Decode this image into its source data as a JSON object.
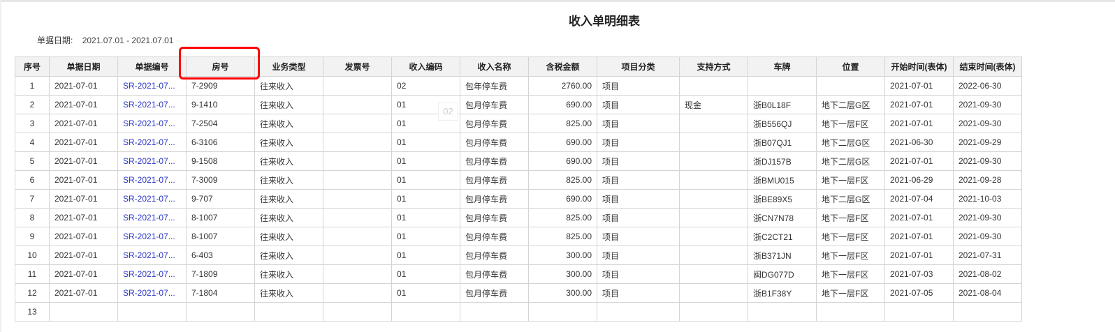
{
  "report": {
    "title": "收入单明细表",
    "date_label": "单据日期:",
    "date_range": "2021.07.01 - 2021.07.01",
    "page_marker": "02"
  },
  "colors": {
    "header_bg": "#f2f2f2",
    "link": "#2a35c8",
    "highlight": "#ff0000",
    "border": "#d4d4d4"
  },
  "table": {
    "columns": [
      "序号",
      "单据日期",
      "单据编号",
      "房号",
      "业务类型",
      "发票号",
      "收入编码",
      "收入名称",
      "含税金额",
      "项目分类",
      "支持方式",
      "车牌",
      "位置",
      "开始时间(表体)",
      "结束时间(表体)"
    ],
    "rows": [
      [
        "1",
        "2021-07-01",
        "SR-2021-07...",
        "7-2909",
        "往来收入",
        "",
        "02",
        "包年停车费",
        "2760.00",
        "项目",
        "",
        "",
        "",
        "2021-07-01",
        "2022-06-30"
      ],
      [
        "2",
        "2021-07-01",
        "SR-2021-07...",
        "9-1410",
        "往来收入",
        "",
        "01",
        "包月停车费",
        "690.00",
        "项目",
        "现金",
        "浙B0L18F",
        "地下二层G区",
        "2021-07-01",
        "2021-09-30"
      ],
      [
        "3",
        "2021-07-01",
        "SR-2021-07...",
        "7-2504",
        "往来收入",
        "",
        "01",
        "包月停车费",
        "825.00",
        "项目",
        "",
        "浙B556QJ",
        "地下一层F区",
        "2021-07-01",
        "2021-09-30"
      ],
      [
        "4",
        "2021-07-01",
        "SR-2021-07...",
        "6-3106",
        "往来收入",
        "",
        "01",
        "包月停车费",
        "690.00",
        "项目",
        "",
        "浙B07QJ1",
        "地下二层G区",
        "2021-06-30",
        "2021-09-29"
      ],
      [
        "5",
        "2021-07-01",
        "SR-2021-07...",
        "9-1508",
        "往来收入",
        "",
        "01",
        "包月停车费",
        "690.00",
        "项目",
        "",
        "浙DJ157B",
        "地下二层G区",
        "2021-07-01",
        "2021-09-30"
      ],
      [
        "6",
        "2021-07-01",
        "SR-2021-07...",
        "7-3009",
        "往来收入",
        "",
        "01",
        "包月停车费",
        "825.00",
        "项目",
        "",
        "浙BMU015",
        "地下一层F区",
        "2021-06-29",
        "2021-09-28"
      ],
      [
        "7",
        "2021-07-01",
        "SR-2021-07...",
        "9-707",
        "往来收入",
        "",
        "01",
        "包月停车费",
        "690.00",
        "项目",
        "",
        "浙BE89X5",
        "地下二层G区",
        "2021-07-04",
        "2021-10-03"
      ],
      [
        "8",
        "2021-07-01",
        "SR-2021-07...",
        "8-1007",
        "往来收入",
        "",
        "01",
        "包月停车费",
        "825.00",
        "项目",
        "",
        "浙CN7N78",
        "地下一层F区",
        "2021-07-01",
        "2021-09-30"
      ],
      [
        "9",
        "2021-07-01",
        "SR-2021-07...",
        "8-1007",
        "往来收入",
        "",
        "01",
        "包月停车费",
        "825.00",
        "项目",
        "",
        "浙C2CT21",
        "地下一层F区",
        "2021-07-01",
        "2021-09-30"
      ],
      [
        "10",
        "2021-07-01",
        "SR-2021-07...",
        "6-403",
        "往来收入",
        "",
        "01",
        "包月停车费",
        "300.00",
        "项目",
        "",
        "浙B371JN",
        "地下一层F区",
        "2021-07-01",
        "2021-07-31"
      ],
      [
        "11",
        "2021-07-01",
        "SR-2021-07...",
        "7-1809",
        "往来收入",
        "",
        "01",
        "包月停车费",
        "300.00",
        "项目",
        "",
        "闽DG077D",
        "地下一层F区",
        "2021-07-03",
        "2021-08-02"
      ],
      [
        "12",
        "2021-07-01",
        "SR-2021-07...",
        "7-1804",
        "往来收入",
        "",
        "01",
        "包月停车费",
        "300.00",
        "项目",
        "",
        "浙B1F38Y",
        "地下一层F区",
        "2021-07-05",
        "2021-08-04"
      ],
      [
        "13",
        "",
        "",
        "",
        "",
        "",
        "",
        "",
        "",
        "",
        "",
        "",
        "",
        "",
        ""
      ]
    ]
  }
}
